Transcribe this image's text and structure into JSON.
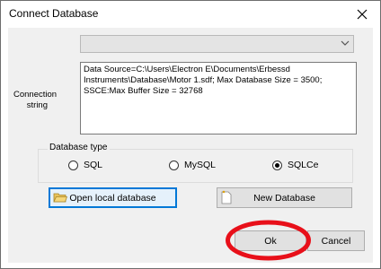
{
  "window": {
    "title": "Connect Database"
  },
  "provider_combo": {
    "value": ""
  },
  "connection": {
    "label_line1": "Connection",
    "label_line2": "string",
    "lines": [
      "Data Source=C:\\Users\\Electron E\\Documents\\Erbessd",
      "Instruments\\Database\\Motor 1.sdf; Max Database Size = 3500;",
      "SSCE:Max Buffer Size = 32768"
    ]
  },
  "database_type": {
    "legend": "Database type",
    "options": [
      {
        "label": "SQL",
        "selected": false
      },
      {
        "label": "MySQL",
        "selected": false
      },
      {
        "label": "SQLCe",
        "selected": true
      }
    ]
  },
  "buttons": {
    "open_local": "Open local database",
    "new_database": "New Database",
    "ok": "Ok",
    "cancel": "Cancel"
  },
  "colors": {
    "focus": "#0078d7",
    "annotation": "#e8101a"
  },
  "icons": {
    "close": "close-icon",
    "open": "folder-open-icon",
    "new": "new-file-icon",
    "dropdown": "chevron-down-icon"
  }
}
